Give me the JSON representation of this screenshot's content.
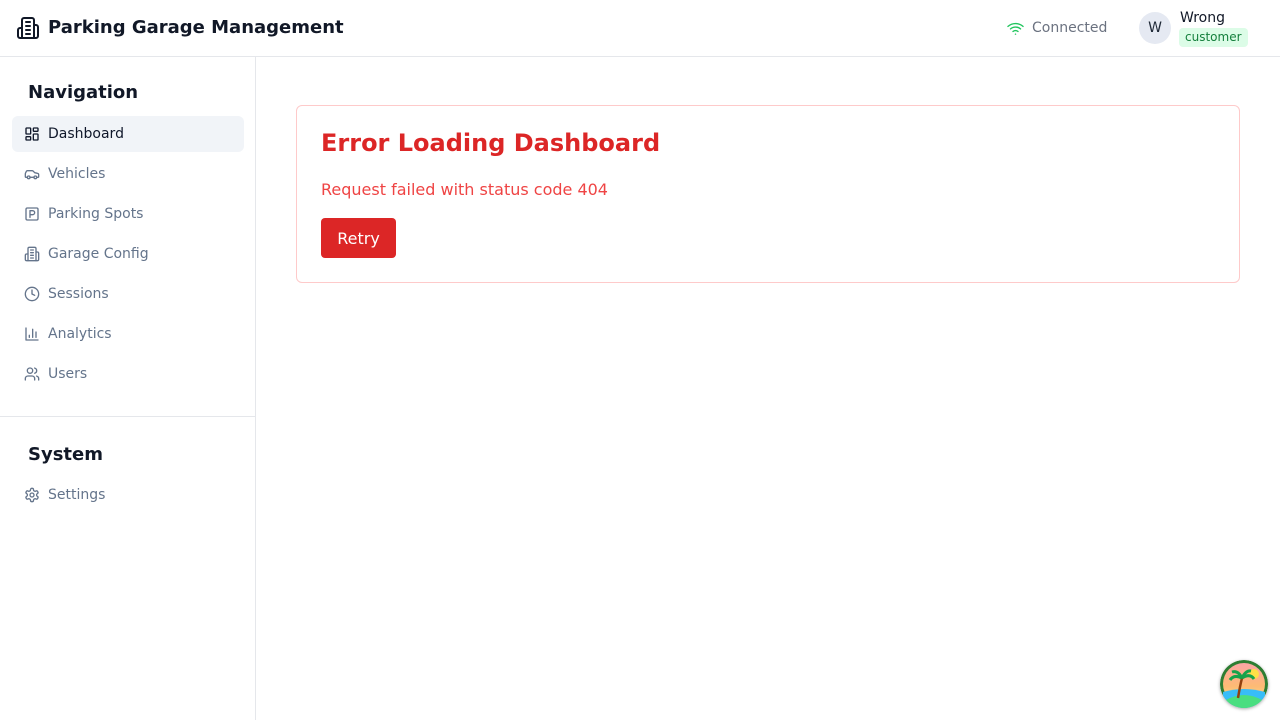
{
  "header": {
    "title": "Parking Garage Management",
    "connection_status": "Connected",
    "user": {
      "initial": "W",
      "name": "Wrong",
      "role": "customer"
    }
  },
  "sidebar": {
    "navigation_title": "Navigation",
    "items": [
      {
        "label": "Dashboard",
        "icon": "dashboard-icon",
        "active": true
      },
      {
        "label": "Vehicles",
        "icon": "car-icon"
      },
      {
        "label": "Parking Spots",
        "icon": "parking-icon"
      },
      {
        "label": "Garage Config",
        "icon": "building-icon"
      },
      {
        "label": "Sessions",
        "icon": "clock-icon"
      },
      {
        "label": "Analytics",
        "icon": "bar-chart-icon"
      },
      {
        "label": "Users",
        "icon": "users-icon"
      }
    ],
    "system_title": "System",
    "system_items": [
      {
        "label": "Settings",
        "icon": "gear-icon"
      }
    ]
  },
  "main": {
    "error": {
      "title": "Error Loading Dashboard",
      "message": "Request failed with status code 404",
      "retry_label": "Retry"
    }
  },
  "colors": {
    "error": "#dc2626",
    "connected": "#22c55e",
    "role_badge_bg": "#dcfce7",
    "role_badge_text": "#15803d"
  }
}
